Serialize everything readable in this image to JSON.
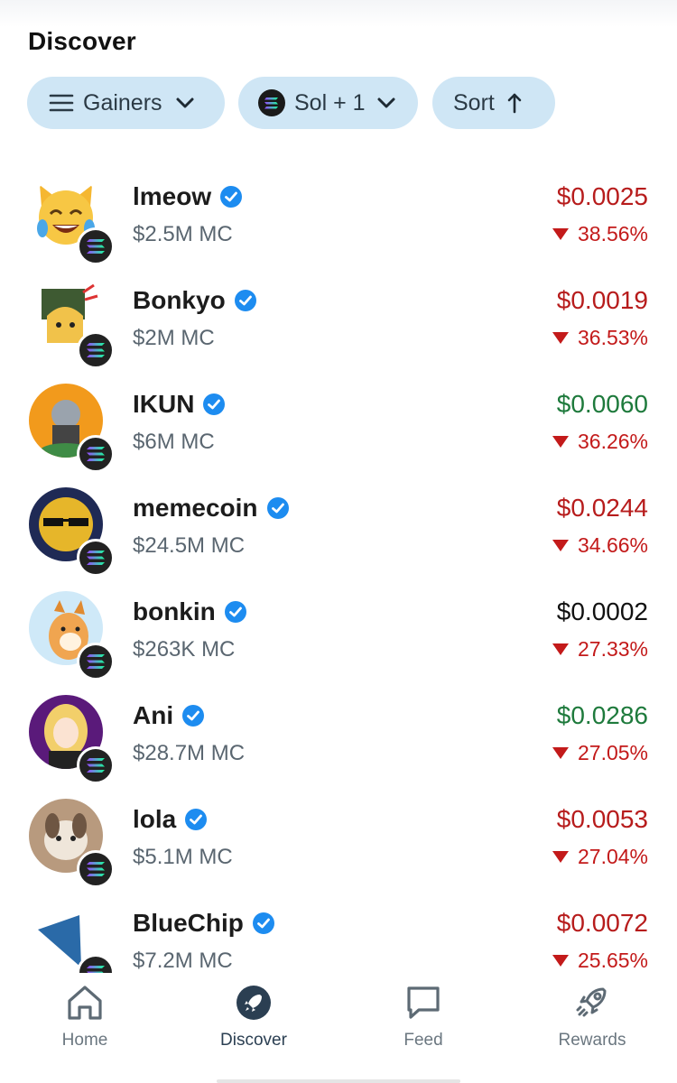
{
  "page_title": "Discover",
  "filters": {
    "gainers_label": "Gainers",
    "chain_label": "Sol + 1",
    "sort_label": "Sort"
  },
  "tokens": [
    {
      "name": "lmeow",
      "mc": "$2.5M MC",
      "price": "$0.0025",
      "price_color": "#b71c1c",
      "change": "38.56%",
      "direction": "down"
    },
    {
      "name": "Bonkyo",
      "mc": "$2M MC",
      "price": "$0.0019",
      "price_color": "#b71c1c",
      "change": "36.53%",
      "direction": "down"
    },
    {
      "name": "IKUN",
      "mc": "$6M MC",
      "price": "$0.0060",
      "price_color": "#1e7a3c",
      "change": "36.26%",
      "direction": "down"
    },
    {
      "name": "memecoin",
      "mc": "$24.5M MC",
      "price": "$0.0244",
      "price_color": "#b71c1c",
      "change": "34.66%",
      "direction": "down"
    },
    {
      "name": "bonkin",
      "mc": "$263K MC",
      "price": "$0.0002",
      "price_color": "#111111",
      "change": "27.33%",
      "direction": "down"
    },
    {
      "name": "Ani",
      "mc": "$28.7M MC",
      "price": "$0.0286",
      "price_color": "#1e7a3c",
      "change": "27.05%",
      "direction": "down"
    },
    {
      "name": "lola",
      "mc": "$5.1M MC",
      "price": "$0.0053",
      "price_color": "#b71c1c",
      "change": "27.04%",
      "direction": "down"
    },
    {
      "name": "BlueChip",
      "mc": "$7.2M MC",
      "price": "$0.0072",
      "price_color": "#b71c1c",
      "change": "25.65%",
      "direction": "down"
    }
  ],
  "nav": {
    "home": "Home",
    "discover": "Discover",
    "feed": "Feed",
    "rewards": "Rewards"
  },
  "colors": {
    "pill_bg": "#cfe6f5",
    "verified": "#1d8cf0",
    "down": "#c31a1a",
    "up": "#1e7a3c",
    "nav_active": "#2b3f52"
  }
}
